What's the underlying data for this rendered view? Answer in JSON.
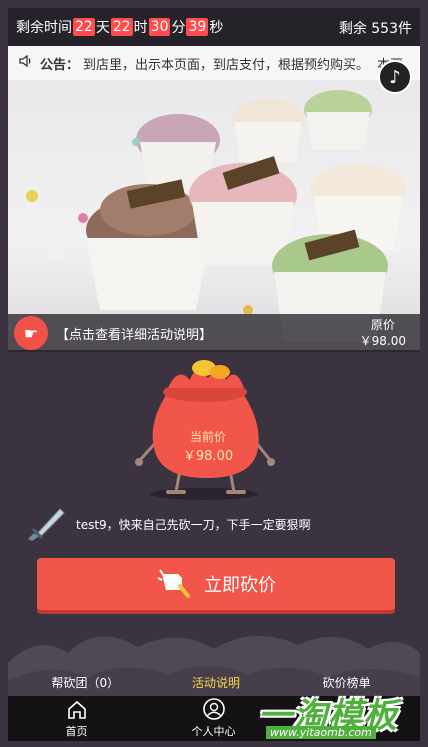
{
  "countdown": {
    "prefix": "剩余时间",
    "days": "22",
    "days_unit": "天",
    "hours": "22",
    "hours_unit": "时",
    "minutes": "30",
    "minutes_unit": "分",
    "seconds": "39",
    "seconds_unit": "秒",
    "remain": "剩余 553件"
  },
  "notice": {
    "label": "公告：",
    "text": "到店里，出示本页面，到店支付，根据预约购买。",
    "trail": "本要"
  },
  "hero": {
    "link_text": "【点击查看详细活动说明】",
    "original_label": "原价",
    "original_price": "￥98.00"
  },
  "bag": {
    "current_label": "当前价",
    "current_price": "￥98.00"
  },
  "chop_message": "test9，快来自己先砍一刀，下手一定要狠啊",
  "cut_button": "立即砍价",
  "tabs": [
    "帮砍团（0）",
    "活动说明",
    "砍价榜单"
  ],
  "nav": {
    "home": "首页",
    "user": "个人中心",
    "third": ""
  },
  "watermark": {
    "main": "一淘模板",
    "url": "www.yitaomb.com"
  },
  "colors": {
    "accent": "#f2564b",
    "countdown_num": "#ff4c4c",
    "bg": "#3b3340"
  }
}
